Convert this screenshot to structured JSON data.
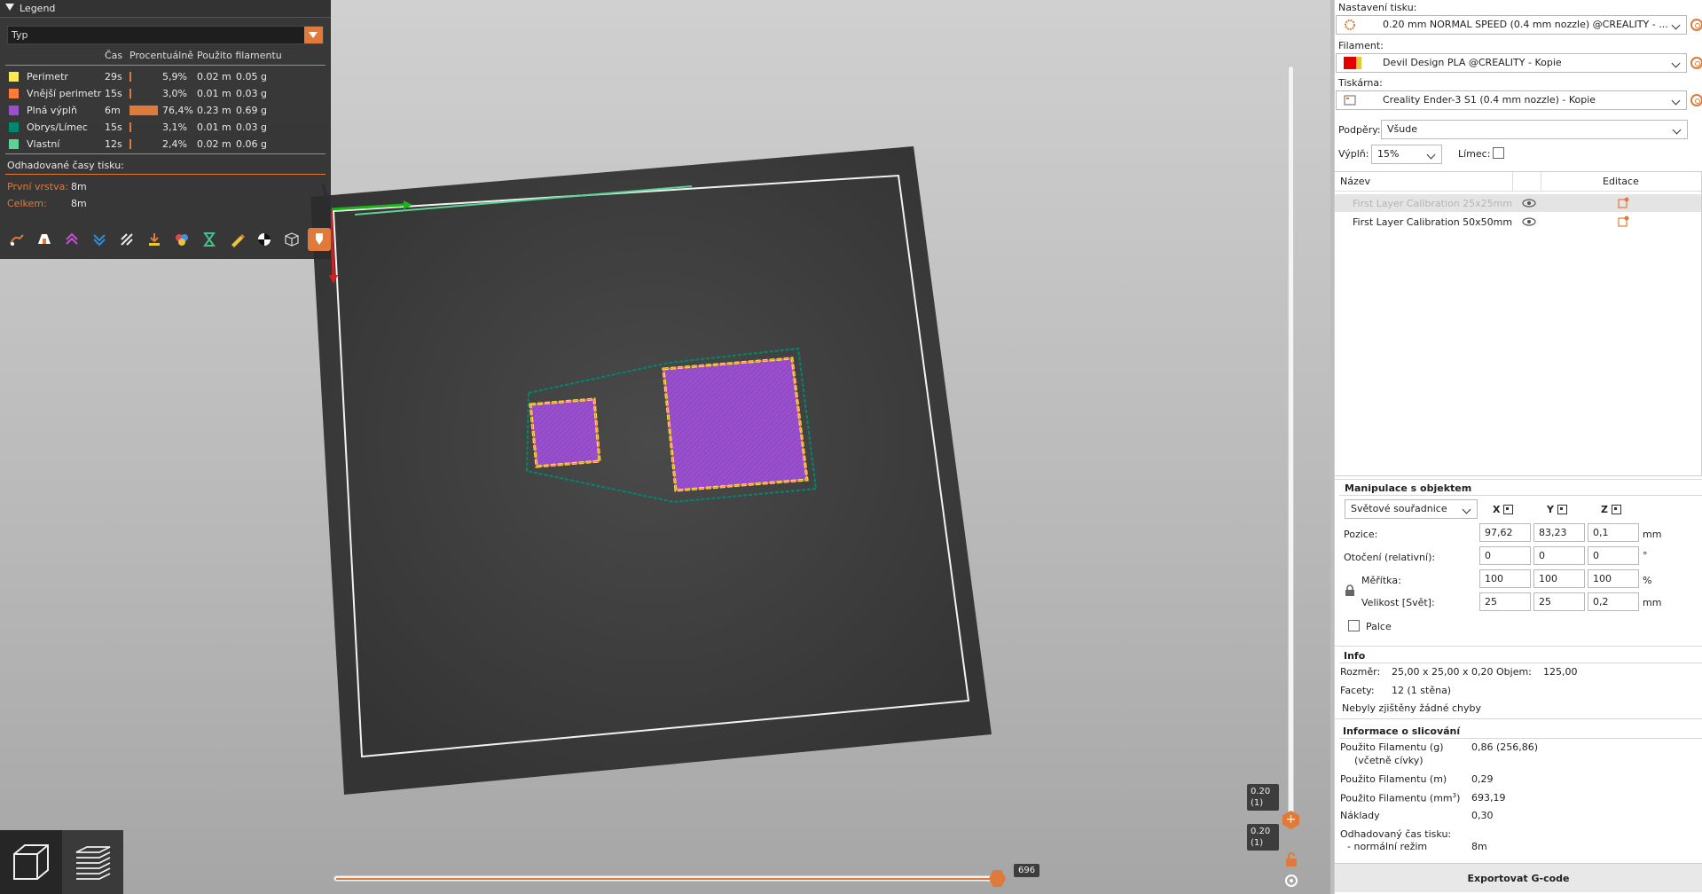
{
  "legend": {
    "title": "Legend",
    "combo": "Typ",
    "headers": {
      "time": "Čas",
      "percent": "Procentuálně",
      "used": "Použito filamentu"
    },
    "rows": [
      {
        "name": "Perimetr",
        "time": "29s",
        "pct": "5,9%",
        "pct_value": 5.9,
        "len": "0.02 m",
        "wt": "0.05 g",
        "color": "#FFE94E"
      },
      {
        "name": "Vnější perimetr",
        "time": "15s",
        "pct": "3,0%",
        "pct_value": 3.0,
        "len": "0.01 m",
        "wt": "0.03 g",
        "color": "#FF7D38"
      },
      {
        "name": "Plná výplň",
        "time": "6m",
        "pct": "76,4%",
        "pct_value": 76.4,
        "len": "0.23 m",
        "wt": "0.69 g",
        "color": "#9A4FCC"
      },
      {
        "name": "Obrys/Límec",
        "time": "15s",
        "pct": "3,1%",
        "pct_value": 3.1,
        "len": "0.01 m",
        "wt": "0.03 g",
        "color": "#00876E"
      },
      {
        "name": "Vlastní",
        "time": "12s",
        "pct": "2,4%",
        "pct_value": 2.4,
        "len": "0.02 m",
        "wt": "0.06 g",
        "color": "#5ED194"
      }
    ],
    "estimated_label": "Odhadované časy tisku:",
    "first_layer_label": "První vrstva:",
    "first_layer_value": "8m",
    "total_label": "Celkem:",
    "total_value": "8m"
  },
  "sliders": {
    "horizontal_value": "696",
    "vertical_top_label": "0.20\n(1)",
    "vertical_bottom_label": "0.20\n(1)",
    "horizontal_fill_percent": 100,
    "vertical_fill_percent": 100
  },
  "sidebar": {
    "print_settings_label": "Nastavení tisku:",
    "print_settings_value": "0.20 mm NORMAL SPEED (0.4 mm nozzle) @CREALITY - ...",
    "filament_label": "Filament:",
    "filament_value": "Devil Design PLA @CREALITY - Kopie",
    "filament_color": "#E50000",
    "printer_label": "Tiskárna:",
    "printer_value": "Creality Ender-3 S1 (0.4 mm nozzle) - Kopie",
    "supports_label": "Podpěry:",
    "supports_value": "Všude",
    "infill_label": "Výplň:",
    "infill_value": "15%",
    "brim_label": "Límec:",
    "objects_header_name": "Název",
    "objects_header_edit": "Editace",
    "objects": [
      {
        "name": "First Layer Calibration 25x25mm"
      },
      {
        "name": "First Layer Calibration 50x50mm"
      }
    ]
  },
  "manipulation": {
    "title": "Manipulace s objektem",
    "coords_combo": "Světové souřadnice",
    "axis_x": "X",
    "axis_y": "Y",
    "axis_z": "Z",
    "position_label": "Pozice:",
    "position": [
      "97,62",
      "83,23",
      "0,1"
    ],
    "position_unit": "mm",
    "rotation_label": "Otočení (relativní):",
    "rotation": [
      "0",
      "0",
      "0"
    ],
    "rotation_unit": "°",
    "scale_label": "Měřítka:",
    "scale": [
      "100",
      "100",
      "100"
    ],
    "scale_unit": "%",
    "size_label": "Velikost [Svět]:",
    "size": [
      "25",
      "25",
      "0,2"
    ],
    "size_unit": "mm",
    "inches_label": "Palce"
  },
  "info": {
    "title": "Info",
    "size_label": "Rozměr:",
    "size_value": "25,00 x 25,00 x 0,20",
    "volume_label": "Objem:",
    "volume_value": "125,00",
    "facets_label": "Facety:",
    "facets_value": "12 (1 stěna)",
    "errors_text": "Nebyly zjištěny žádné chyby"
  },
  "slicing": {
    "title": "Informace o slicování",
    "used_g_label": "Použito Filamentu (g)",
    "used_g_sub": "(včetně cívky)",
    "used_g_value": "0,86 (256,86)",
    "used_m_label": "Použito Filamentu (m)",
    "used_m_value": "0,29",
    "used_mm3_label": "Použito Filamentu (mm",
    "used_mm3_sup": "3",
    "used_mm3_close": ")",
    "used_mm3_value": "693,19",
    "cost_label": "Náklady",
    "cost_value": "0,30",
    "est_time_label": "Odhadovaný čas tisku:",
    "normal_mode_label": "- normální režim",
    "normal_mode_value": "8m"
  },
  "export_label": "Exportovat G-code",
  "colors": {
    "accent": "#E07A3A",
    "bed": "#3B3B3B",
    "infill": "#9A4FCC",
    "perimeter": "#FFE94E",
    "skirt": "#00876E"
  }
}
